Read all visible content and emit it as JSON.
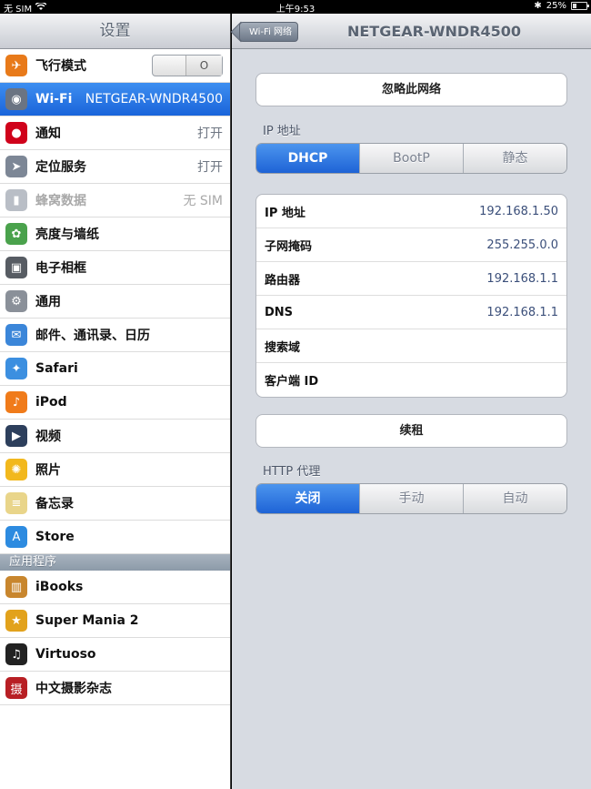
{
  "status": {
    "carrier": "无 SIM",
    "time": "上午9:53",
    "battery_percent": "25%",
    "battery_level": 0.25
  },
  "sidebar": {
    "title": "设置",
    "items": [
      {
        "label": "飞行模式",
        "value": "",
        "icon": "airplane-icon",
        "color": "#e87a1a",
        "toggle_state": "O"
      },
      {
        "label": "Wi-Fi",
        "value": "NETGEAR-WNDR4500",
        "icon": "wifi-icon",
        "color": "#6b7482"
      },
      {
        "label": "通知",
        "value": "打开",
        "icon": "notification-icon",
        "color": "#d0021b"
      },
      {
        "label": "定位服务",
        "value": "打开",
        "icon": "location-icon",
        "color": "#7d8796"
      },
      {
        "label": "蜂窝数据",
        "value": "无 SIM",
        "icon": "cellular-icon",
        "color": "#b9bec6"
      },
      {
        "label": "亮度与墙纸",
        "value": "",
        "icon": "brightness-icon",
        "color": "#4aa24c"
      },
      {
        "label": "电子相框",
        "value": "",
        "icon": "picture-frame-icon",
        "color": "#575c63"
      },
      {
        "label": "通用",
        "value": "",
        "icon": "gear-icon",
        "color": "#8a9099"
      },
      {
        "label": "邮件、通讯录、日历",
        "value": "",
        "icon": "mail-icon",
        "color": "#3b86d9"
      },
      {
        "label": "Safari",
        "value": "",
        "icon": "safari-icon",
        "color": "#3c8fe0"
      },
      {
        "label": "iPod",
        "value": "",
        "icon": "ipod-icon",
        "color": "#f07b1a"
      },
      {
        "label": "视频",
        "value": "",
        "icon": "video-icon",
        "color": "#2d3f5c"
      },
      {
        "label": "照片",
        "value": "",
        "icon": "photos-icon",
        "color": "#f2b81d"
      },
      {
        "label": "备忘录",
        "value": "",
        "icon": "notes-icon",
        "color": "#e9d58a"
      },
      {
        "label": "Store",
        "value": "",
        "icon": "store-icon",
        "color": "#2d8be0"
      }
    ],
    "apps_header": "应用程序",
    "apps": [
      {
        "label": "iBooks",
        "icon": "ibooks-icon",
        "color": "#c8862e"
      },
      {
        "label": "Super Mania 2",
        "icon": "super-mania-icon",
        "color": "#e2a21c"
      },
      {
        "label": "Virtuoso",
        "icon": "virtuoso-icon",
        "color": "#222222"
      },
      {
        "label": "中文摄影杂志",
        "icon": "photo-magazine-icon",
        "color": "#b81f24"
      }
    ]
  },
  "detail": {
    "back_label": "Wi-Fi 网络",
    "title": "NETGEAR-WNDR4500",
    "forget_button": "忽略此网络",
    "ip_section_label": "IP 地址",
    "ip_modes": [
      "DHCP",
      "BootP",
      "静态"
    ],
    "ip_mode_selected": 0,
    "fields": [
      {
        "label": "IP 地址",
        "value": "192.168.1.50"
      },
      {
        "label": "子网掩码",
        "value": "255.255.0.0"
      },
      {
        "label": "路由器",
        "value": "192.168.1.1"
      },
      {
        "label": "DNS",
        "value": "192.168.1.1"
      },
      {
        "label": "搜索域",
        "value": ""
      },
      {
        "label": "客户端 ID",
        "value": ""
      }
    ],
    "renew_button": "续租",
    "proxy_section_label": "HTTP 代理",
    "proxy_modes": [
      "关闭",
      "手动",
      "自动"
    ],
    "proxy_mode_selected": 0
  },
  "colors": {
    "accent": "#1e63d6",
    "background": "#d7dbe2"
  }
}
